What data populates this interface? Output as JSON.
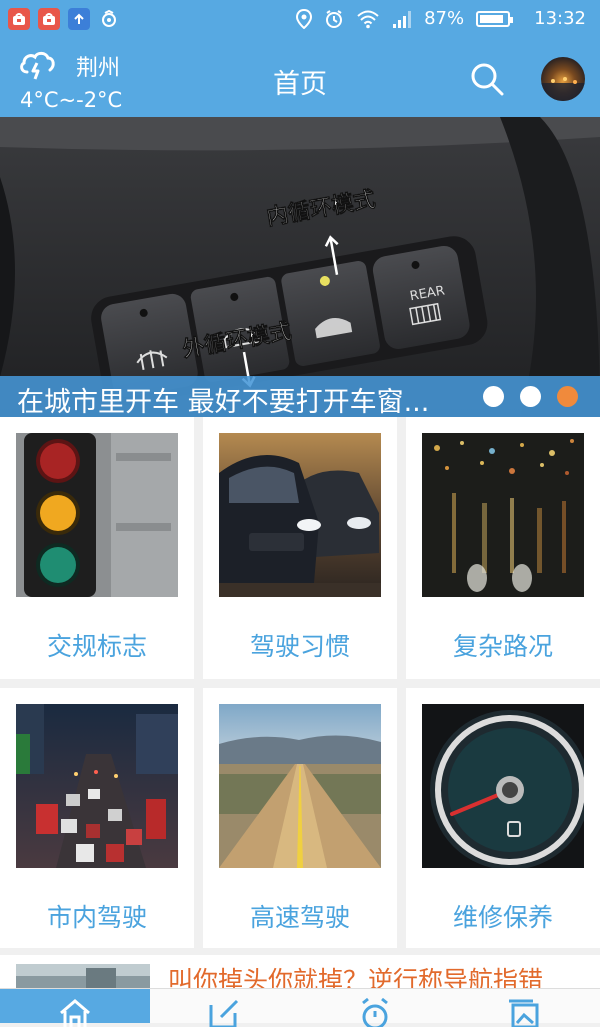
{
  "status_bar": {
    "battery_percent": "87%",
    "battery_level": 0.87,
    "time": "13:32",
    "notification_icons": [
      "app-notification-icon",
      "app-notification-icon",
      "upload-icon",
      "sync-icon"
    ],
    "system_icons": [
      "location-icon",
      "alarm-icon",
      "wifi-icon",
      "signal-icon",
      "battery-icon"
    ]
  },
  "header": {
    "weather": {
      "city": "荆州",
      "temperature": "4°C~-2°C",
      "icon": "cloud-lightning-icon"
    },
    "title": "首页",
    "search_icon": "search-icon"
  },
  "banner": {
    "caption": "在城市里开车  最好不要打开车窗...",
    "labels": {
      "inner_circulation": "内循环模式",
      "outer_circulation": "外循环模式",
      "rear_button": "REAR"
    },
    "dots": 3,
    "active_dot": 2,
    "dot_active_color": "#f08a3c"
  },
  "categories": [
    {
      "label": "交规标志",
      "image": "traffic-light-photo"
    },
    {
      "label": "驾驶习惯",
      "image": "cars-photo"
    },
    {
      "label": "复杂路况",
      "image": "rainy-windshield-photo"
    },
    {
      "label": "市内驾驶",
      "image": "city-traffic-photo"
    },
    {
      "label": "高速驾驶",
      "image": "highway-photo"
    },
    {
      "label": "维修保养",
      "image": "fuel-gauge-photo"
    }
  ],
  "article": {
    "title": "叫你掉头你就掉？逆行称导航指错"
  },
  "tab_bar": {
    "active_index": 0,
    "tabs": [
      {
        "icon": "home-icon"
      },
      {
        "icon": "edit-icon"
      },
      {
        "icon": "alarm-clock-icon"
      },
      {
        "icon": "gallery-icon"
      }
    ]
  },
  "colors": {
    "accent": "#57a9e2",
    "label_text": "#4aa3de",
    "article_text": "#e26a2c"
  }
}
